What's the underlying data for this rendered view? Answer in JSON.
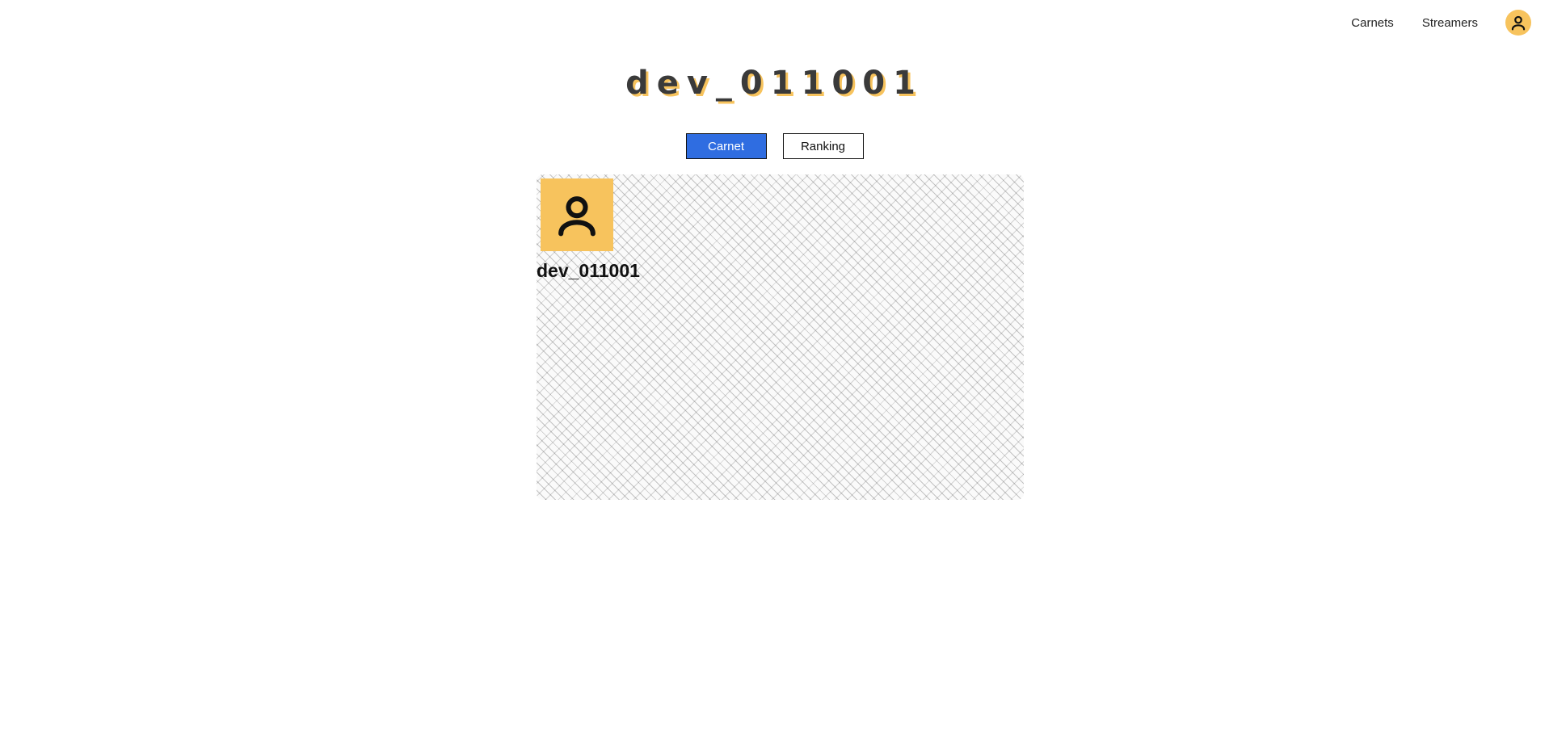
{
  "nav": {
    "links": [
      "Carnets",
      "Streamers"
    ],
    "avatar_icon": "user-icon",
    "avatar_color": "#f7c35d"
  },
  "profile": {
    "title": "dev_011001",
    "username": "dev_011001",
    "avatar_icon": "user-icon",
    "avatar_color": "#f7c35d"
  },
  "tabs": [
    {
      "label": "Carnet",
      "active": true
    },
    {
      "label": "Ranking",
      "active": false
    }
  ],
  "colors": {
    "accent": "#2f6de1",
    "title_shadow": "#f7c35d"
  }
}
